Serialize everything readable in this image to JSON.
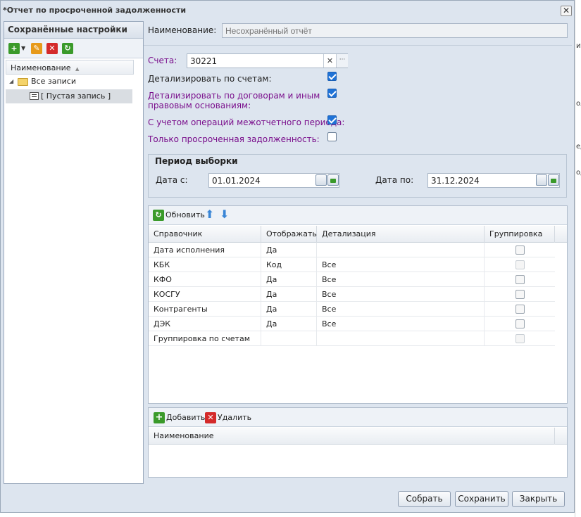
{
  "window": {
    "title": "*Отчет по просроченной задолженности",
    "close_label": "✕"
  },
  "left_panel": {
    "title": "Сохранённые настройки",
    "tools": [
      {
        "name": "add-icon",
        "color": "#3a9a2a",
        "glyph": "+"
      },
      {
        "name": "edit-icon",
        "color": "#e79a1a",
        "glyph": "✎"
      },
      {
        "name": "delete-icon",
        "color": "#d42a2a",
        "glyph": "✕"
      },
      {
        "name": "refresh-icon",
        "color": "#3a9a2a",
        "glyph": "↻"
      }
    ],
    "column": "Наименование",
    "sort_arrow": "▲",
    "tree": {
      "root": "Все записи",
      "child": "[ Пустая запись ]"
    }
  },
  "form": {
    "name_label": "Наименование:",
    "name_placeholder": "Несохранённый отчёт",
    "accounts_label": "Счета:",
    "accounts_value": "30221",
    "clear_glyph": "✕",
    "more_glyph": "···",
    "checks": [
      {
        "label": "Детализировать по счетам:",
        "checked": true,
        "purple": false
      },
      {
        "label": "Детализировать по договорам и иным",
        "label2": "правовым основаниям:",
        "checked": true,
        "purple": true
      },
      {
        "label": "С учетом операций межотчетного периода:",
        "checked": true,
        "purple": true
      },
      {
        "label": "Только просроченная задолженность:",
        "checked": false,
        "purple": true
      }
    ]
  },
  "period": {
    "legend": "Период выборки",
    "date_from_label": "Дата с:",
    "date_from": "01.01.2024",
    "date_to_label": "Дата по:",
    "date_to": "31.12.2024"
  },
  "grid": {
    "refresh_label": "Обновить",
    "columns": [
      "Справочник",
      "Отображать",
      "Детализация",
      "Группировка"
    ],
    "rows": [
      {
        "ref": "Дата исполнения",
        "show": "Да",
        "detail": "",
        "group": "grey"
      },
      {
        "ref": "КБК",
        "show": "Код",
        "detail": "Все",
        "group": "dis"
      },
      {
        "ref": "КФО",
        "show": "Да",
        "detail": "Все",
        "group": "grey"
      },
      {
        "ref": "КОСГУ",
        "show": "Да",
        "detail": "Все",
        "group": "grey"
      },
      {
        "ref": "Контрагенты",
        "show": "Да",
        "detail": "Все",
        "group": "grey"
      },
      {
        "ref": "ДЭК",
        "show": "Да",
        "detail": "Все",
        "group": "grey"
      },
      {
        "ref": "Группировка по счетам",
        "show": "",
        "detail": "",
        "group": "dis"
      }
    ]
  },
  "bottom_panel": {
    "add_label": "Добавить",
    "delete_label": "Удалить",
    "column": "Наименование"
  },
  "buttons": {
    "collect": "Собрать",
    "save": "Сохранить",
    "close": "Закрыть"
  },
  "background": {
    "cells": [
      "ит",
      "ол",
      "ед",
      "од"
    ]
  }
}
